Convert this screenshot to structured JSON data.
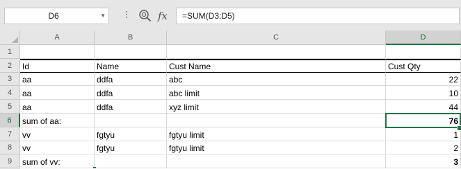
{
  "formula_bar": {
    "name_box": "D6",
    "formula": "=SUM(D3:D5)"
  },
  "icons": {
    "name_box_dropdown": "chevron-down-icon",
    "zoom": "magnifier-icon",
    "function": "fx-icon",
    "select_all": "select-all-icon"
  },
  "columns": [
    "A",
    "B",
    "C",
    "D"
  ],
  "selected_column": "D",
  "rows": [
    "1",
    "2",
    "3",
    "4",
    "5",
    "6",
    "7",
    "8",
    "9"
  ],
  "selected_row": "6",
  "sheet": {
    "header": [
      "Id",
      "Name",
      "Cust Name",
      "Cust Qty"
    ],
    "data": [
      [
        "aa",
        "ddfa",
        "abc",
        "22"
      ],
      [
        "aa",
        "ddfa",
        "abc limit",
        "10"
      ],
      [
        "aa",
        "ddfa",
        "xyz limit",
        "44"
      ],
      [
        "sum of aa:",
        "",
        "",
        "76"
      ],
      [
        "vv",
        "fgtyu",
        "fgtyu limit",
        "1"
      ],
      [
        "vv",
        "fgtyu",
        "fgtyu limit",
        "2"
      ],
      [
        "sum of vv:",
        "",
        "",
        "3"
      ]
    ]
  },
  "colors": {
    "accent": "#217346",
    "header_bg": "#e6e6e6",
    "gridline": "#dadada"
  }
}
